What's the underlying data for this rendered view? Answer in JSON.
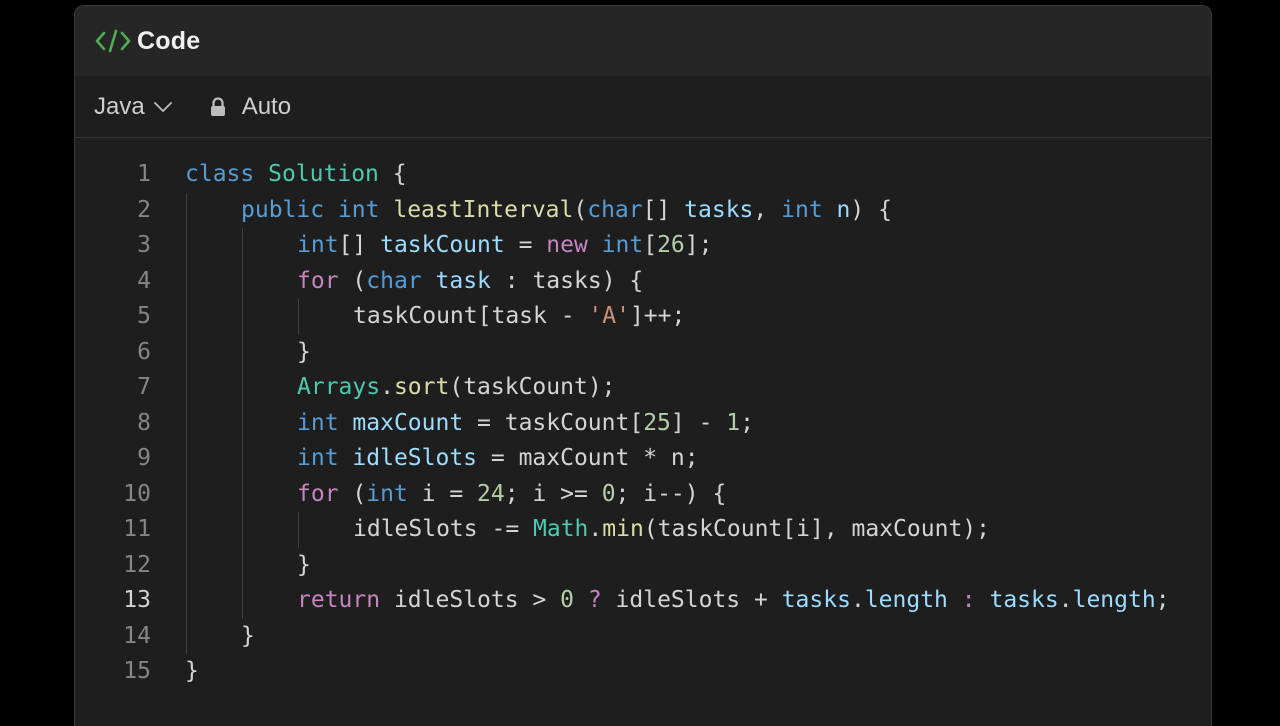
{
  "header": {
    "title": "Code",
    "icon": "code-icon"
  },
  "toolbar": {
    "language": "Java",
    "mode_label": "Auto"
  },
  "colors": {
    "icon_green": "#4caf50",
    "keyword": "#569cd6",
    "control": "#c586c0",
    "type": "#4ec9b0",
    "function": "#dcdcaa",
    "variable": "#9cdcfe",
    "number": "#b5cea8",
    "string": "#ce9178"
  },
  "editor": {
    "active_line": 13,
    "lines": [
      {
        "n": "1",
        "indent": 0,
        "tokens": [
          [
            "kw",
            "class"
          ],
          [
            "pl",
            " "
          ],
          [
            "ty",
            "Solution"
          ],
          [
            "pl",
            " {"
          ]
        ]
      },
      {
        "n": "2",
        "indent": 1,
        "tokens": [
          [
            "kw",
            "public"
          ],
          [
            "pl",
            " "
          ],
          [
            "kw",
            "int"
          ],
          [
            "pl",
            " "
          ],
          [
            "fn",
            "leastInterval"
          ],
          [
            "pl",
            "("
          ],
          [
            "kw",
            "char"
          ],
          [
            "pl",
            "[] "
          ],
          [
            "var",
            "tasks"
          ],
          [
            "pl",
            ", "
          ],
          [
            "kw",
            "int"
          ],
          [
            "pl",
            " "
          ],
          [
            "var",
            "n"
          ],
          [
            "pl",
            ") {"
          ]
        ]
      },
      {
        "n": "3",
        "indent": 2,
        "tokens": [
          [
            "kw",
            "int"
          ],
          [
            "pl",
            "[] "
          ],
          [
            "var",
            "taskCount"
          ],
          [
            "pl",
            " = "
          ],
          [
            "ctl",
            "new"
          ],
          [
            "pl",
            " "
          ],
          [
            "kw",
            "int"
          ],
          [
            "pl",
            "["
          ],
          [
            "num",
            "26"
          ],
          [
            "pl",
            "];"
          ]
        ]
      },
      {
        "n": "4",
        "indent": 2,
        "tokens": [
          [
            "ctl",
            "for"
          ],
          [
            "pl",
            " ("
          ],
          [
            "kw",
            "char"
          ],
          [
            "pl",
            " "
          ],
          [
            "var",
            "task"
          ],
          [
            "pl",
            " : "
          ],
          [
            "pl",
            "tasks"
          ],
          [
            "pl",
            ") {"
          ]
        ]
      },
      {
        "n": "5",
        "indent": 3,
        "tokens": [
          [
            "pl",
            "taskCount[task - "
          ],
          [
            "str",
            "'A'"
          ],
          [
            "pl",
            "]++;"
          ]
        ]
      },
      {
        "n": "6",
        "indent": 2,
        "tokens": [
          [
            "pl",
            "}"
          ]
        ]
      },
      {
        "n": "7",
        "indent": 2,
        "tokens": [
          [
            "ty",
            "Arrays"
          ],
          [
            "pl",
            "."
          ],
          [
            "fn",
            "sort"
          ],
          [
            "pl",
            "(taskCount);"
          ]
        ]
      },
      {
        "n": "8",
        "indent": 2,
        "tokens": [
          [
            "kw",
            "int"
          ],
          [
            "pl",
            " "
          ],
          [
            "var",
            "maxCount"
          ],
          [
            "pl",
            " = taskCount["
          ],
          [
            "num",
            "25"
          ],
          [
            "pl",
            "] - "
          ],
          [
            "num",
            "1"
          ],
          [
            "pl",
            ";"
          ]
        ]
      },
      {
        "n": "9",
        "indent": 2,
        "tokens": [
          [
            "kw",
            "int"
          ],
          [
            "pl",
            " "
          ],
          [
            "var",
            "idleSlots"
          ],
          [
            "pl",
            " = maxCount * n;"
          ]
        ]
      },
      {
        "n": "10",
        "indent": 2,
        "tokens": [
          [
            "ctl",
            "for"
          ],
          [
            "pl",
            " ("
          ],
          [
            "kw",
            "int"
          ],
          [
            "pl",
            " i = "
          ],
          [
            "num",
            "24"
          ],
          [
            "pl",
            "; i >= "
          ],
          [
            "num",
            "0"
          ],
          [
            "pl",
            "; i--) {"
          ]
        ]
      },
      {
        "n": "11",
        "indent": 3,
        "tokens": [
          [
            "pl",
            "idleSlots -= "
          ],
          [
            "ty",
            "Math"
          ],
          [
            "pl",
            "."
          ],
          [
            "fn",
            "min"
          ],
          [
            "pl",
            "(taskCount[i], maxCount);"
          ]
        ]
      },
      {
        "n": "12",
        "indent": 2,
        "tokens": [
          [
            "pl",
            "}"
          ]
        ]
      },
      {
        "n": "13",
        "indent": 2,
        "tokens": [
          [
            "ctl",
            "return"
          ],
          [
            "pl",
            " idleSlots > "
          ],
          [
            "num",
            "0"
          ],
          [
            "pl",
            " "
          ],
          [
            "ctl",
            "?"
          ],
          [
            "pl",
            " idleSlots + "
          ],
          [
            "var",
            "tasks"
          ],
          [
            "pl",
            "."
          ],
          [
            "var",
            "length"
          ],
          [
            "pl",
            " "
          ],
          [
            "ctl",
            ":"
          ],
          [
            "pl",
            " "
          ],
          [
            "var",
            "tasks"
          ],
          [
            "pl",
            "."
          ],
          [
            "var",
            "length"
          ],
          [
            "pl",
            ";"
          ]
        ]
      },
      {
        "n": "14",
        "indent": 1,
        "tokens": [
          [
            "pl",
            "}"
          ]
        ]
      },
      {
        "n": "15",
        "indent": 0,
        "tokens": [
          [
            "pl",
            "}"
          ]
        ]
      }
    ]
  }
}
